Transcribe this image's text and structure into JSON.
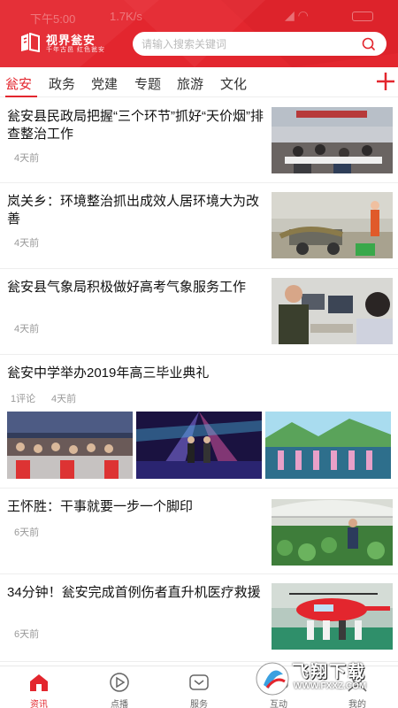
{
  "status": {
    "time": "下午5:00",
    "speed": "1.7K/s"
  },
  "app": {
    "logo_name": "视界瓮安",
    "logo_slogan": "千年古邑 红色瓮安"
  },
  "search": {
    "placeholder": "请输入搜索关键词"
  },
  "tabs": [
    {
      "label": "瓮安",
      "active": true
    },
    {
      "label": "政务",
      "active": false
    },
    {
      "label": "党建",
      "active": false
    },
    {
      "label": "专题",
      "active": false
    },
    {
      "label": "旅游",
      "active": false
    },
    {
      "label": "文化",
      "active": false
    }
  ],
  "news": [
    {
      "title": "瓮安县民政局把握“三个环节”抓好“天价烟”排查整治工作",
      "time": "4天前"
    },
    {
      "title": "岚关乡：环境整治抓出成效人居环境大为改善",
      "time": "4天前"
    },
    {
      "title": "瓮安县气象局积极做好高考气象服务工作",
      "time": "4天前"
    },
    {
      "title": "瓮安中学举办2019年高三毕业典礼",
      "comments": "1评论",
      "time": "4天前"
    },
    {
      "title": "王怀胜：干事就要一步一个脚印",
      "time": "6天前"
    },
    {
      "title": "34分钟！瓮安完成首例伤者直升机医疗救援",
      "time": "6天前"
    }
  ],
  "nav": [
    {
      "label": "资讯",
      "icon": "home-icon",
      "active": true
    },
    {
      "label": "点播",
      "icon": "play-icon",
      "active": false
    },
    {
      "label": "服务",
      "icon": "service-icon",
      "active": false
    },
    {
      "label": "互动",
      "icon": "chat-icon",
      "active": false
    },
    {
      "label": "我的",
      "icon": "user-icon",
      "active": false
    }
  ],
  "watermark": {
    "text": "飞翔下载",
    "url": "WWW.FXXZ.COM"
  },
  "colors": {
    "brand": "#e3262e",
    "muted": "#999999"
  }
}
